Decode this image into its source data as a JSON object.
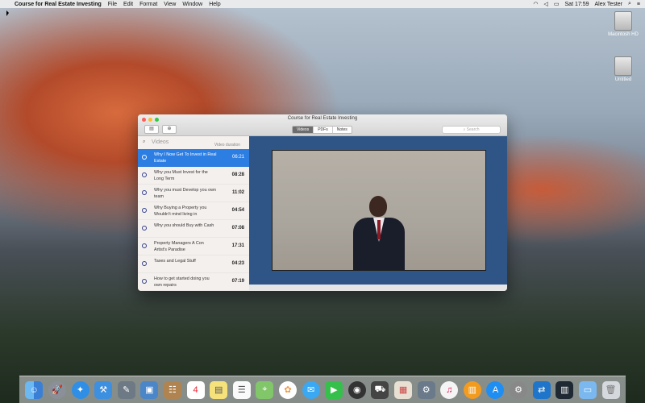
{
  "menubar": {
    "app_name": "Course for Real Estate Investing",
    "items": [
      "File",
      "Edit",
      "Format",
      "View",
      "Window",
      "Help"
    ],
    "time": "Sat 17:59",
    "user": "Alex Tester"
  },
  "desktop": {
    "disks": [
      "Macintosh HD",
      "Untitled"
    ]
  },
  "window": {
    "title": "Course for Real Estate Investing",
    "tabs": [
      "Videos",
      "PDFs",
      "Notes"
    ],
    "active_tab": "Videos",
    "search_placeholder": "Search",
    "sidebar": {
      "title": "Videos",
      "duration_header": "Video duration",
      "items": [
        {
          "title": "Why I Now Get To Invest in Real Estate",
          "duration": "06:21"
        },
        {
          "title": "Why you Must Invest for the Long Term",
          "duration": "08:28"
        },
        {
          "title": "Why you must Develop you own team",
          "duration": "11:02"
        },
        {
          "title": "Why Buying a Property you Wouldn't mind living in",
          "duration": "04:54"
        },
        {
          "title": "Why you should Buy with Cash",
          "duration": "07:08"
        },
        {
          "title": "Property Managers A Con Artist's Paradise",
          "duration": "17:31"
        },
        {
          "title": "Taxes and Legal Stuff",
          "duration": "04:23"
        },
        {
          "title": "How to get started doing you own repairs",
          "duration": "07:19"
        }
      ]
    }
  },
  "dock": {
    "apps": [
      "Finder",
      "Launchpad",
      "Safari",
      "Xcode",
      "Utilities",
      "Preview",
      "Contacts",
      "Calendar",
      "Notes",
      "Reminders",
      "Maps",
      "Photos",
      "Messages",
      "FaceTime",
      "Activity",
      "Car",
      "Image Viewer",
      "Instruments",
      "iTunes",
      "iBooks",
      "App Store",
      "System Preferences",
      "TeamViewer",
      "Building",
      "Folder",
      "Trash"
    ],
    "calendar_day": "4"
  }
}
